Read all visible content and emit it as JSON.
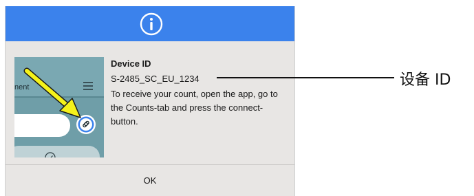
{
  "dialog": {
    "device_title": "Device ID",
    "device_id": "S-2485_SC_EU_1234",
    "description": "To receive your count, open the app, go to the Counts-tab and press the connect-button.",
    "ok_label": "OK",
    "header_icon": "info-icon",
    "header_color": "#3b82ec"
  },
  "thumbnail": {
    "partial_label": "nent",
    "icons": [
      "menu-icon",
      "link-icon",
      "check-icon"
    ],
    "arrow_color": "#f5f21a"
  },
  "annotation": {
    "label": "设备 ID"
  }
}
